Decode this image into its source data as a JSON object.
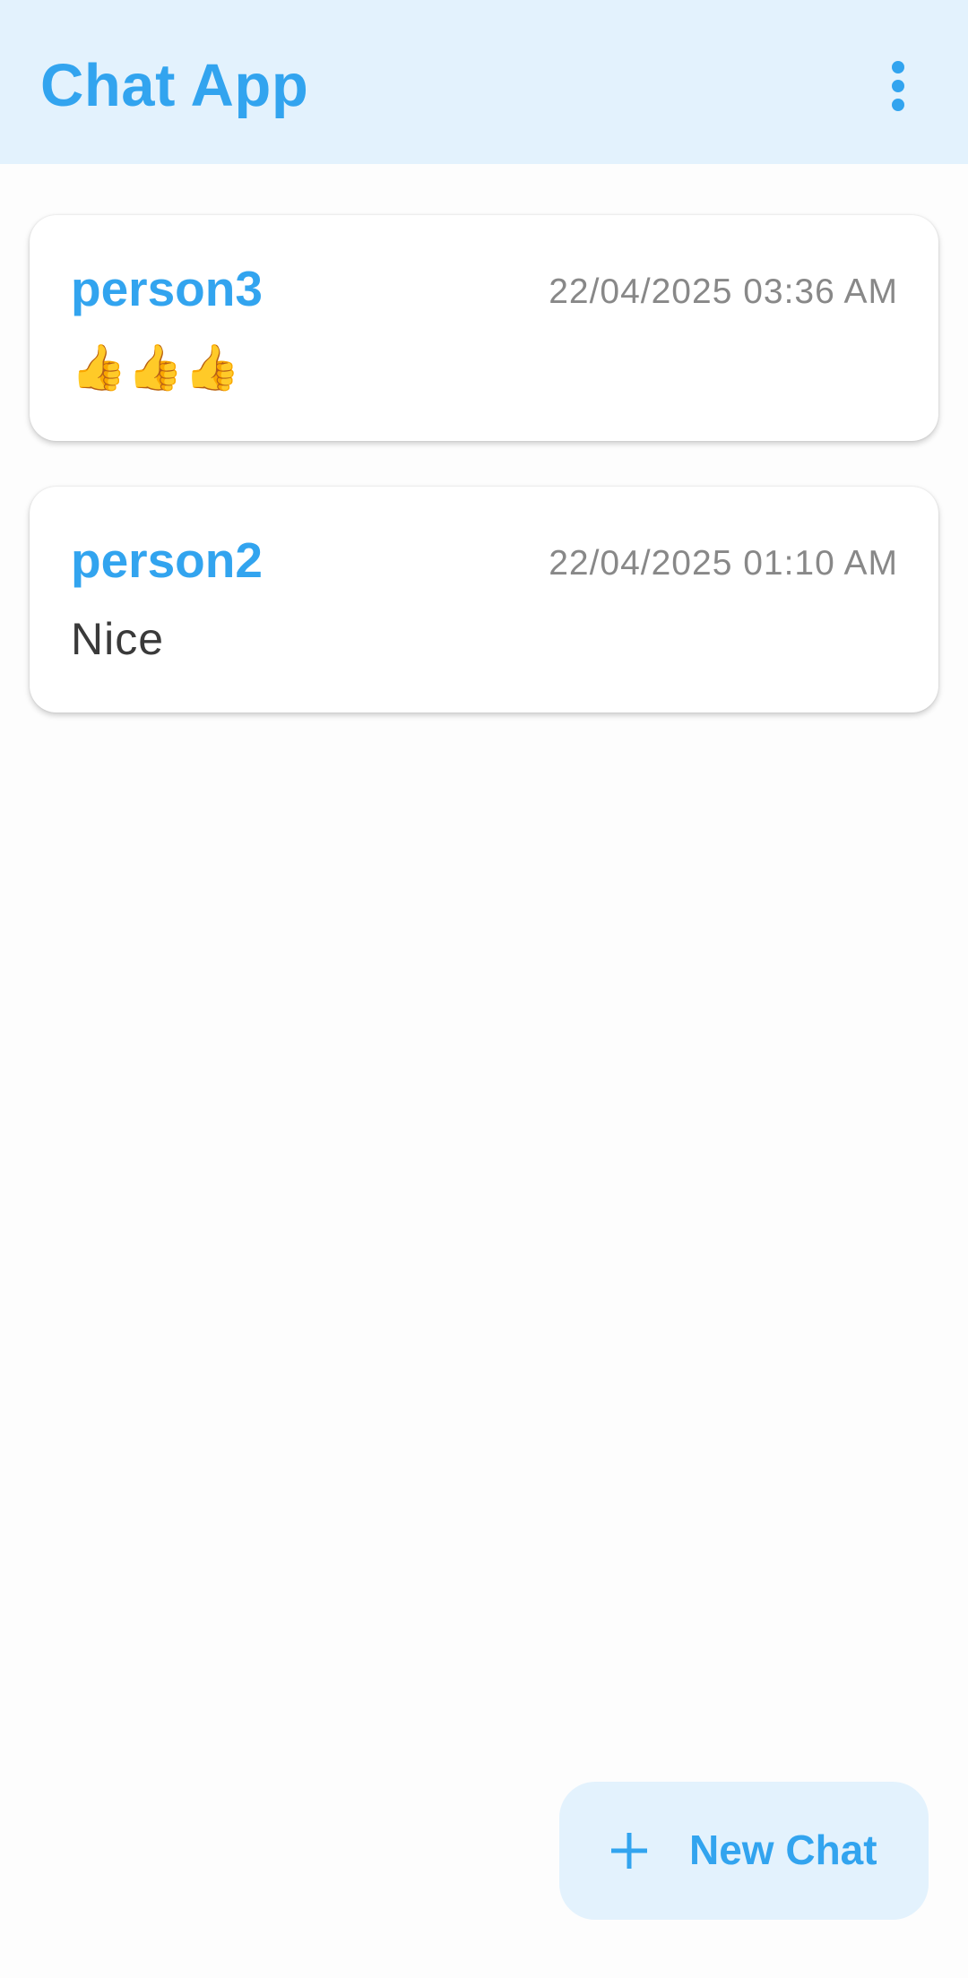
{
  "app_bar": {
    "title": "Chat App",
    "menu_icon": "more-vert-icon"
  },
  "chats": [
    {
      "name": "person3",
      "timestamp": "22/04/2025 03:36 AM",
      "last_message": "👍👍👍"
    },
    {
      "name": "person2",
      "timestamp": "22/04/2025 01:10 AM",
      "last_message": "Nice"
    }
  ],
  "fab": {
    "icon": "plus-icon",
    "label": "New Chat"
  },
  "colors": {
    "accent": "#32a4ef",
    "app_bar_bg": "#e3f2fd",
    "fab_bg": "#e3f2fd",
    "timestamp": "#888888",
    "message": "#3a3a3a"
  }
}
